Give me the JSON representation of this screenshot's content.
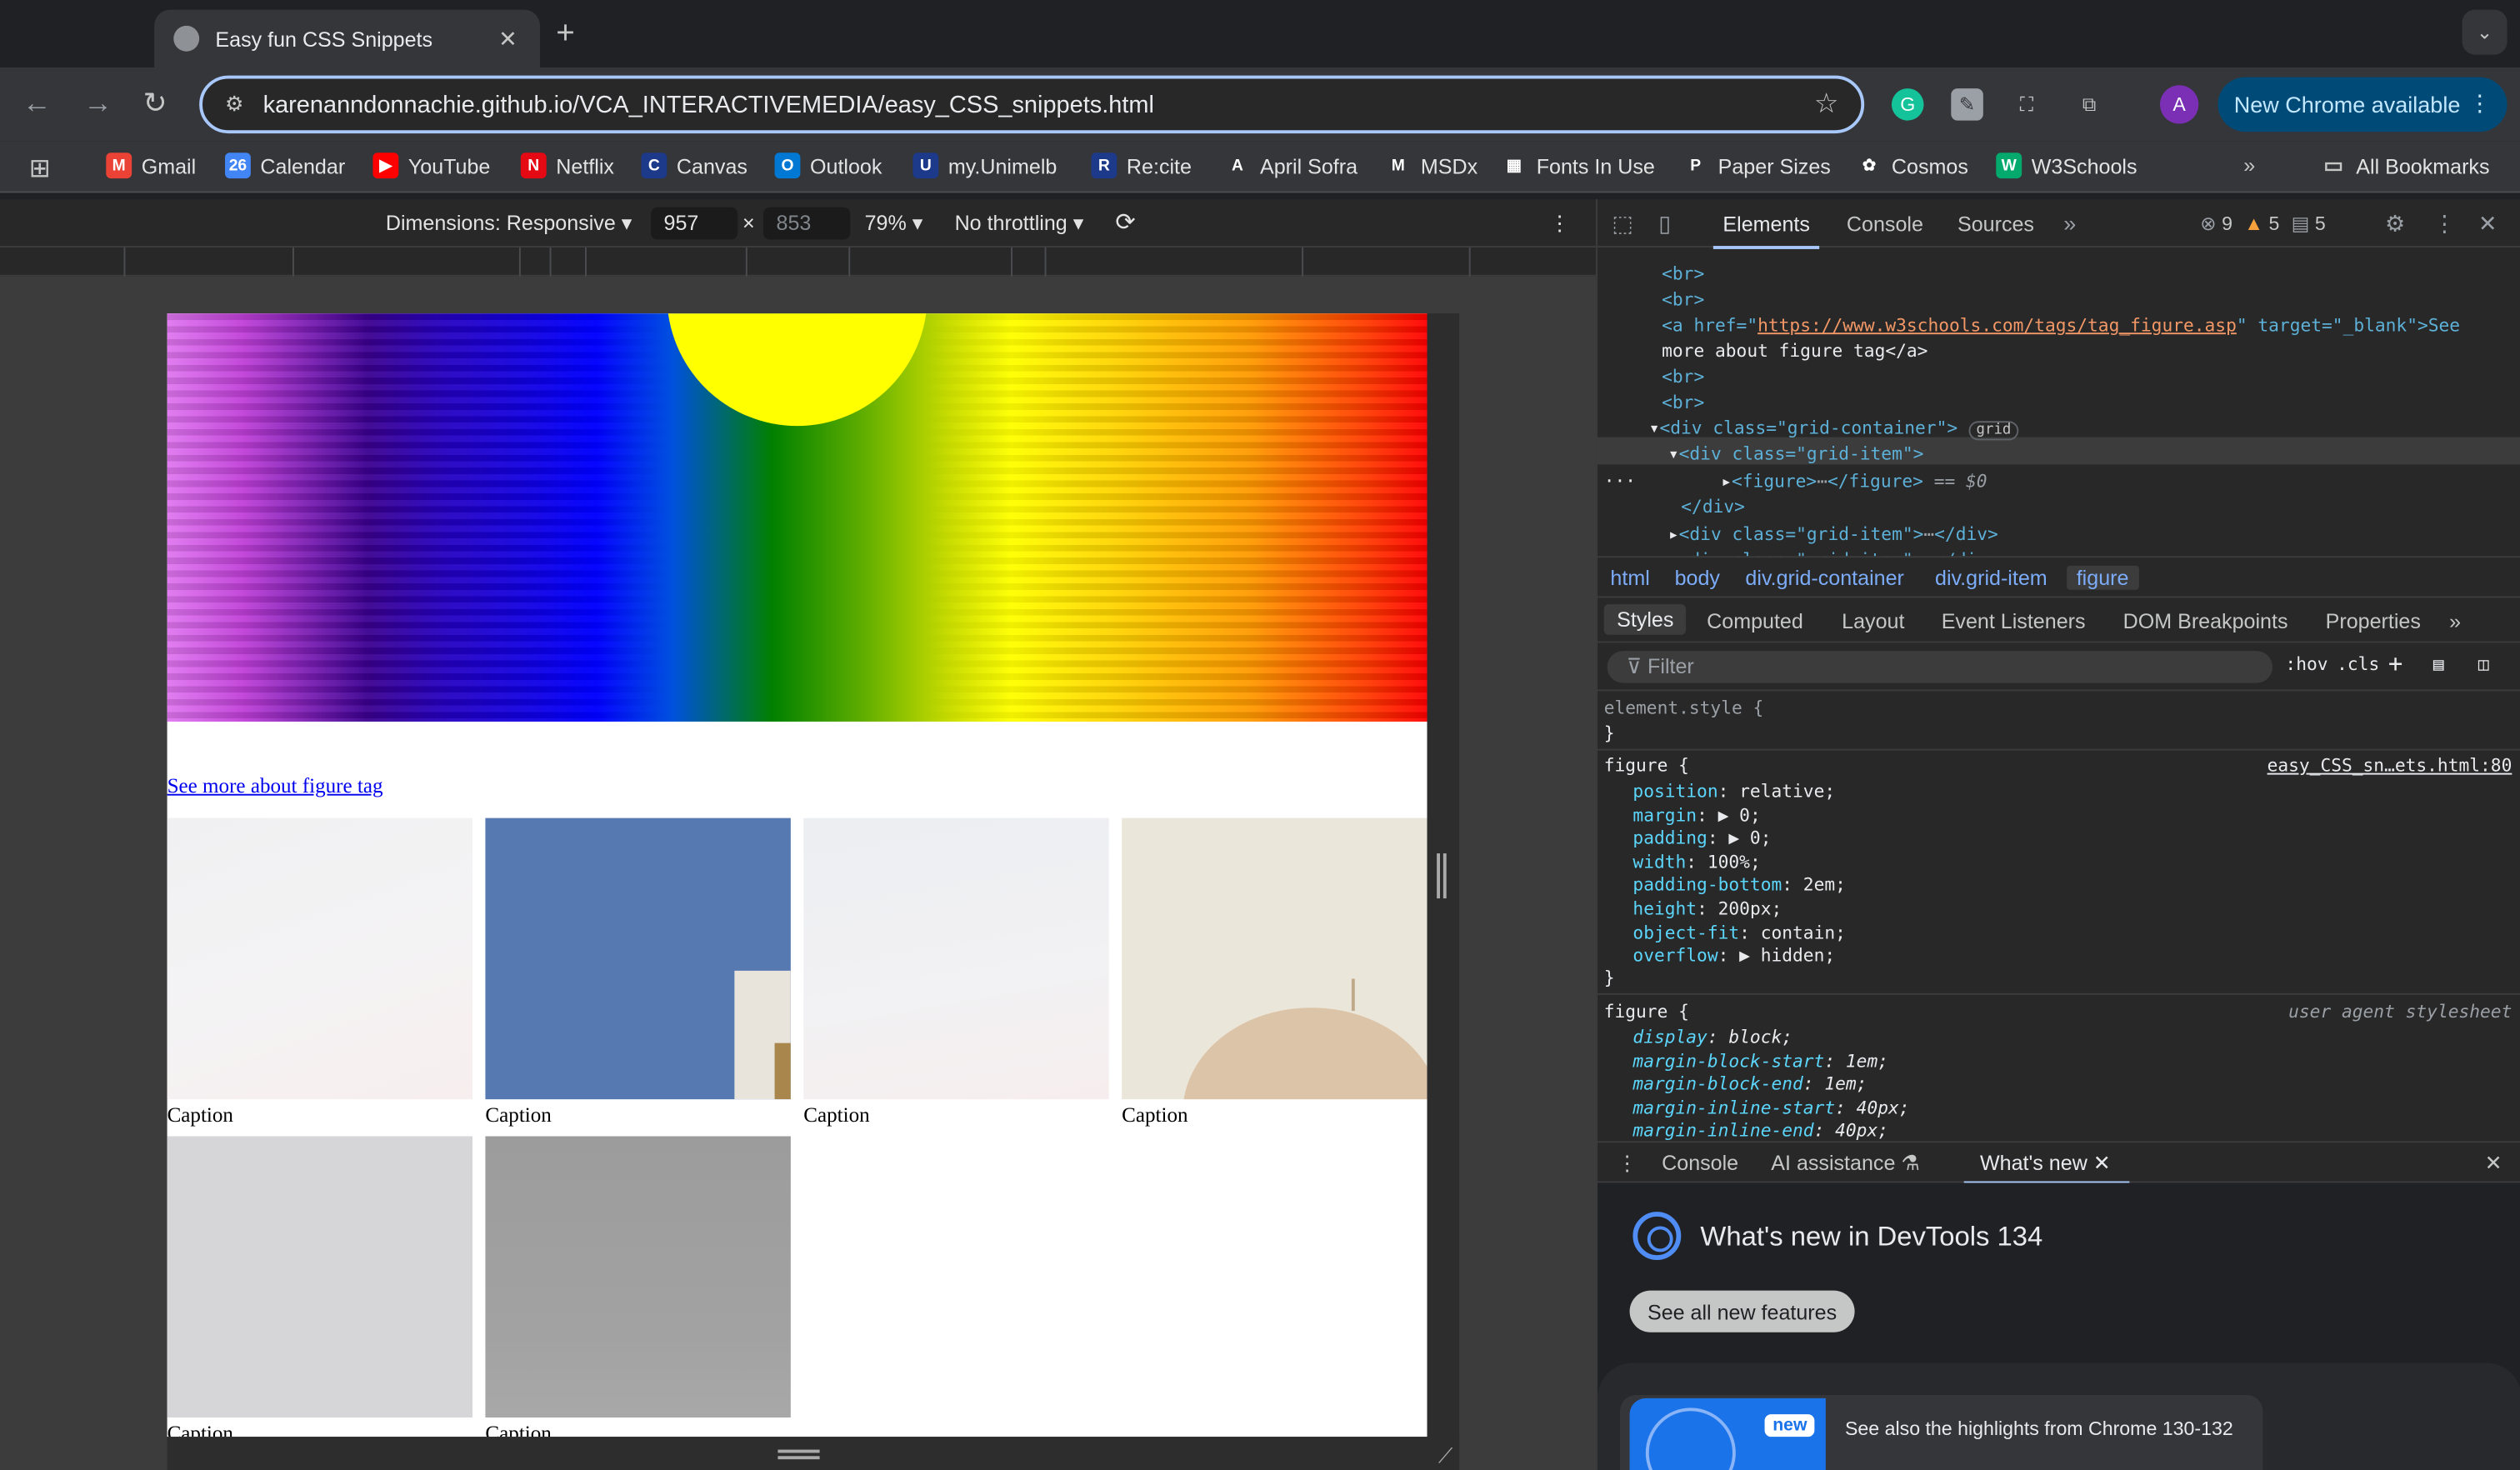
{
  "browser": {
    "tab_title": "Easy fun CSS Snippets",
    "tab_close": "✕",
    "new_tab": "+",
    "url": "karenanndonnachie.github.io/VCA_INTERACTIVEMEDIA/easy_CSS_snippets.html",
    "avatar_letter": "A",
    "update_label": "New Chrome available"
  },
  "bookmarks": [
    {
      "label": "Gmail",
      "icon": "gmail-icon",
      "color": "#ea4335",
      "glyph": "M"
    },
    {
      "label": "Calendar",
      "icon": "calendar-icon",
      "color": "#4285f4",
      "glyph": "26"
    },
    {
      "label": "YouTube",
      "icon": "youtube-icon",
      "color": "#ff0000",
      "glyph": "▶"
    },
    {
      "label": "Netflix",
      "icon": "netflix-icon",
      "color": "#e50914",
      "glyph": "N"
    },
    {
      "label": "Canvas",
      "icon": "canvas-icon",
      "color": "#1d3a8a",
      "glyph": "C"
    },
    {
      "label": "Outlook",
      "icon": "outlook-icon",
      "color": "#0078d4",
      "glyph": "O"
    },
    {
      "label": "my.Unimelb",
      "icon": "unimelb-icon",
      "color": "#1d3a8a",
      "glyph": "U"
    },
    {
      "label": "Re:cite",
      "icon": "recite-icon",
      "color": "#1d3a8a",
      "glyph": "R"
    },
    {
      "label": "April Sofra",
      "icon": "april-sofra-icon",
      "color": "#35363a",
      "glyph": "A"
    },
    {
      "label": "MSDx",
      "icon": "msdx-icon",
      "color": "#35363a",
      "glyph": "M"
    },
    {
      "label": "Fonts In Use",
      "icon": "fonts-in-use-icon",
      "color": "#35363a",
      "glyph": "▦"
    },
    {
      "label": "Paper Sizes",
      "icon": "paper-sizes-icon",
      "color": "#35363a",
      "glyph": "P"
    },
    {
      "label": "Cosmos",
      "icon": "cosmos-icon",
      "color": "#35363a",
      "glyph": "✿"
    },
    {
      "label": "W3Schools",
      "icon": "w3schools-icon",
      "color": "#04aa6d",
      "glyph": "W"
    }
  ],
  "all_bookmarks": "All Bookmarks",
  "device_toolbar": {
    "dimensions": "Dimensions: Responsive",
    "width": "957",
    "height": "853",
    "times": "×",
    "zoom": "79%",
    "throttling": "No throttling"
  },
  "page": {
    "figure_link": "See more about figure tag",
    "captions": [
      "Caption",
      "Caption",
      "Caption",
      "Caption",
      "Caption",
      "Caption"
    ]
  },
  "devtools": {
    "tabs": [
      "Elements",
      "Console",
      "Sources"
    ],
    "errors": "9",
    "warnings": "5",
    "messages": "5",
    "dom": {
      "br1": "<br>",
      "br2": "<br>",
      "a_open": "<a href=\"",
      "a_href": "https://www.w3schools.com/tags/tag_figure.asp",
      "a_target": "\" target=\"_blank\">See",
      "a_text2": "more about figure tag</a>",
      "br3": "<br>",
      "br4": "<br>",
      "grid_container": "<div class=\"grid-container\">",
      "grid_badge": "grid",
      "grid_item": "<div class=\"grid-item\">",
      "figure": "<figure>",
      "figure_close": "</figure>",
      "selected_marker": "== $0",
      "div_close": "</div>",
      "grid_item_collapsed": "<div class=\"grid-item\">",
      "div_close_inline": "</div>"
    },
    "breadcrumbs": [
      "html",
      "body",
      "div.grid-container",
      "div.grid-item",
      "figure"
    ],
    "subtabs": [
      "Styles",
      "Computed",
      "Layout",
      "Event Listeners",
      "DOM Breakpoints",
      "Properties"
    ],
    "filter_placeholder": "Filter",
    "hov": ":hov",
    "cls": ".cls",
    "styles": {
      "element_style": "element.style {",
      "close": "}",
      "rule1_selector": "figure {",
      "rule1_source": "easy_CSS_sn…ets.html:80",
      "rule1_props": [
        {
          "name": "position",
          "value": "relative;"
        },
        {
          "name": "margin",
          "value": "▶ 0;"
        },
        {
          "name": "padding",
          "value": "▶ 0;"
        },
        {
          "name": "width",
          "value": "100%;"
        },
        {
          "name": "padding-bottom",
          "value": "2em;"
        },
        {
          "name": "height",
          "value": "200px;"
        },
        {
          "name": "object-fit",
          "value": "contain;"
        },
        {
          "name": "overflow",
          "value": "▶ hidden;"
        }
      ],
      "rule2_selector": "figure {",
      "rule2_source": "user agent stylesheet",
      "rule2_props": [
        {
          "name": "display",
          "value": "block;"
        },
        {
          "name": "margin-block-start",
          "value": "1em;"
        },
        {
          "name": "margin-block-end",
          "value": "1em;"
        },
        {
          "name": "margin-inline-start",
          "value": "40px;"
        },
        {
          "name": "margin-inline-end",
          "value": "40px;"
        }
      ]
    },
    "drawer_tabs": [
      "Console",
      "AI assistance",
      "What's new"
    ],
    "whats_new_title": "What's new in DevTools 134",
    "see_all": "See all new features",
    "new_badge": "new",
    "highlights": "See also the highlights from Chrome 130-132"
  }
}
